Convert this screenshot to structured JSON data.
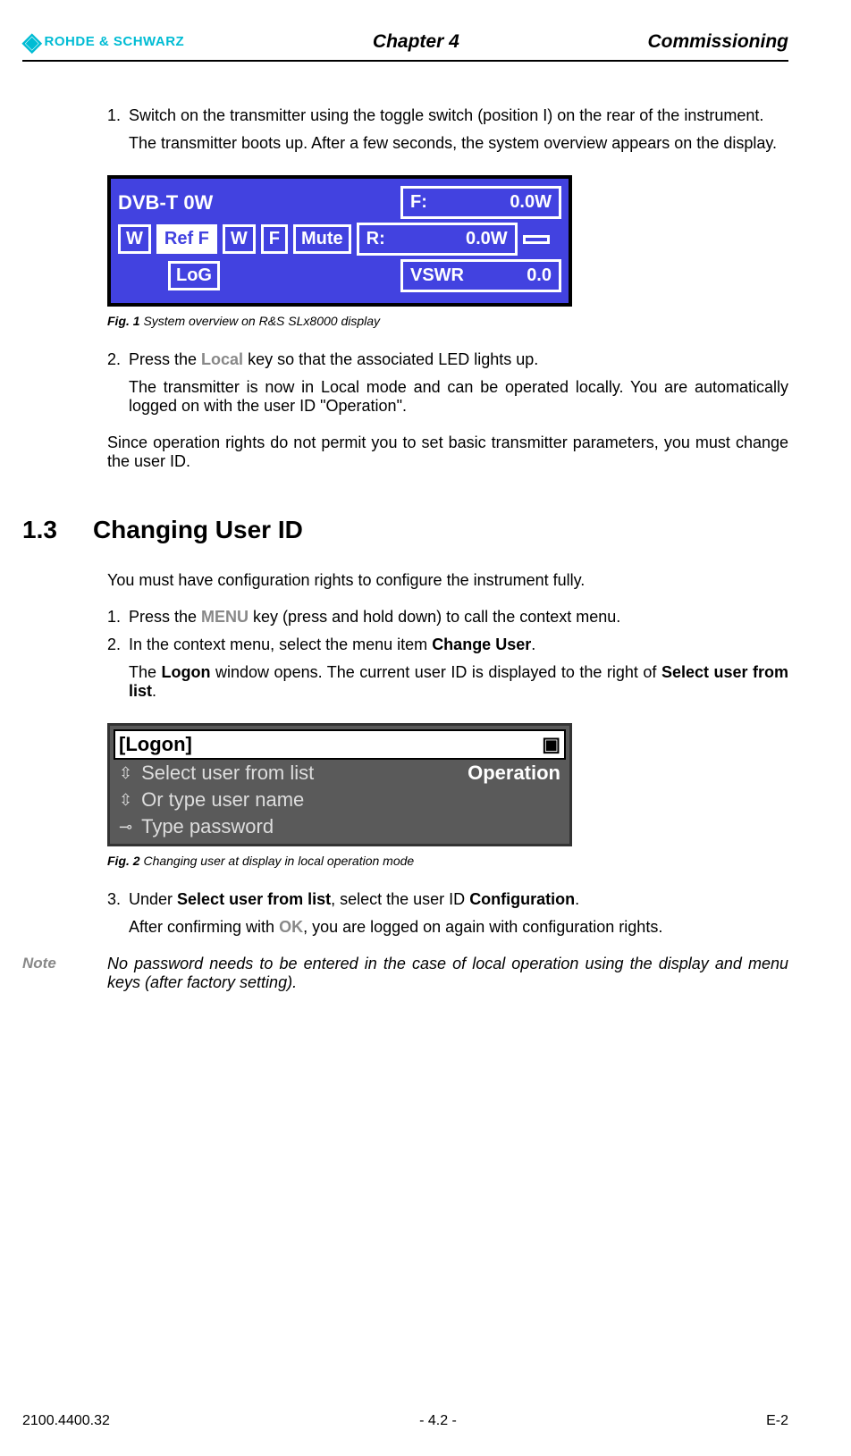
{
  "header": {
    "logo_text": "ROHDE & SCHWARZ",
    "chapter": "Chapter 4",
    "section": "Commissioning"
  },
  "body": {
    "step1_num": "1.",
    "step1": "Switch on the transmitter using the toggle switch (position I) on the rear of the instrument.",
    "step1_sub": "The transmitter boots up. After a few seconds, the system overview appears on the display.",
    "fig1": {
      "title": "DVB-T 0W",
      "f_label": "F:",
      "f_val": "0.0W",
      "w": "W",
      "ref": "Ref F",
      "wf": "W",
      "f2": "F",
      "mute": "Mute",
      "r_label": "R:",
      "r_val": "0.0W",
      "log": "LoG",
      "vswr_label": "VSWR",
      "vswr_val": "0.0",
      "caption_bold": "Fig. 1",
      "caption": "  System overview on R&S SLx8000 display"
    },
    "step2_num": "2.",
    "step2_pre": "Press the ",
    "step2_key": "Local",
    "step2_post": " key so that the associated LED lights up.",
    "step2_sub": "The transmitter is now in Local mode and can be operated locally. You are automatically logged on with the user ID \"Operation\".",
    "para1": "Since operation rights do not permit you to set basic transmitter parameters, you must change the user ID.",
    "h2_num": "1.3",
    "h2_title": "Changing User ID",
    "para2": "You must have configuration rights to configure the instrument fully.",
    "s13_1_num": "1.",
    "s13_1_pre": "Press the ",
    "s13_1_key": "MENU",
    "s13_1_post": " key (press and hold down) to call the context menu.",
    "s13_2_num": "2.",
    "s13_2_pre": "In the context menu, select the menu item ",
    "s13_2_bold": "Change User",
    "s13_2_post": ".",
    "s13_2_sub_pre": "The ",
    "s13_2_sub_b1": "Logon",
    "s13_2_sub_mid": " window opens. The current user ID is displayed to the right of ",
    "s13_2_sub_b2": "Select user from list",
    "s13_2_sub_post": ".",
    "fig2": {
      "title": "[Logon]",
      "row1": "Select user from list",
      "row1_val": "Operation",
      "row2": "Or type user name",
      "row3": "Type password",
      "caption_bold": "Fig. 2",
      "caption": "  Changing user at display in local operation mode"
    },
    "s13_3_num": "3.",
    "s13_3_pre": "Under ",
    "s13_3_b1": "Select user from list",
    "s13_3_mid": ", select the user ID ",
    "s13_3_b2": "Configuration",
    "s13_3_post": ".",
    "s13_3_sub_pre": "After confirming with ",
    "s13_3_sub_key": "OK",
    "s13_3_sub_post": ", you are logged on again with configuration rights.",
    "note_label": "Note",
    "note_text": "No password needs to be entered in the case of local operation using the display and menu keys (after factory setting)."
  },
  "footer": {
    "left": "2100.4400.32",
    "center": "- 4.2 -",
    "right": "E-2"
  }
}
